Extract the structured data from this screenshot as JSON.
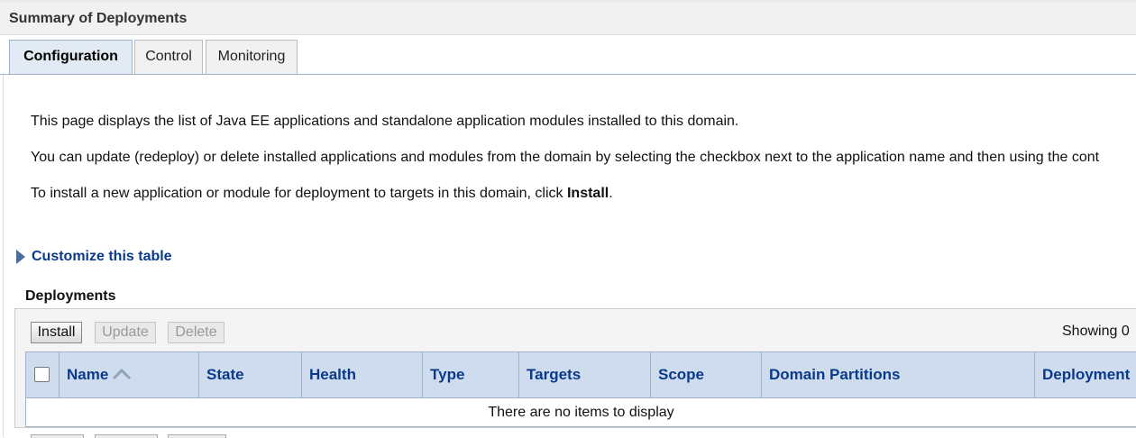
{
  "page": {
    "title": "Summary of Deployments"
  },
  "tabs": [
    {
      "label": "Configuration",
      "active": true
    },
    {
      "label": "Control",
      "active": false
    },
    {
      "label": "Monitoring",
      "active": false
    }
  ],
  "intro": {
    "line1": "This page displays the list of Java EE applications and standalone application modules installed to this domain.",
    "line2": "You can update (redeploy) or delete installed applications and modules from the domain by selecting the checkbox next to the application name and then using the cont",
    "line3_prefix": "To install a new application or module for deployment to targets in this domain, click ",
    "line3_bold": "Install",
    "line3_suffix": "."
  },
  "customize": {
    "label": "Customize this table"
  },
  "deployments": {
    "title": "Deployments",
    "buttons": {
      "install": "Install",
      "update": "Update",
      "delete": "Delete"
    },
    "showing": "Showing 0",
    "columns": [
      "Name",
      "State",
      "Health",
      "Type",
      "Targets",
      "Scope",
      "Domain Partitions",
      "Deployment"
    ],
    "empty_message": "There are no items to display"
  },
  "colors": {
    "header_bg": "#cfdcee",
    "link": "#0b3a8a",
    "active_tab_bg": "#e2ebf4"
  }
}
